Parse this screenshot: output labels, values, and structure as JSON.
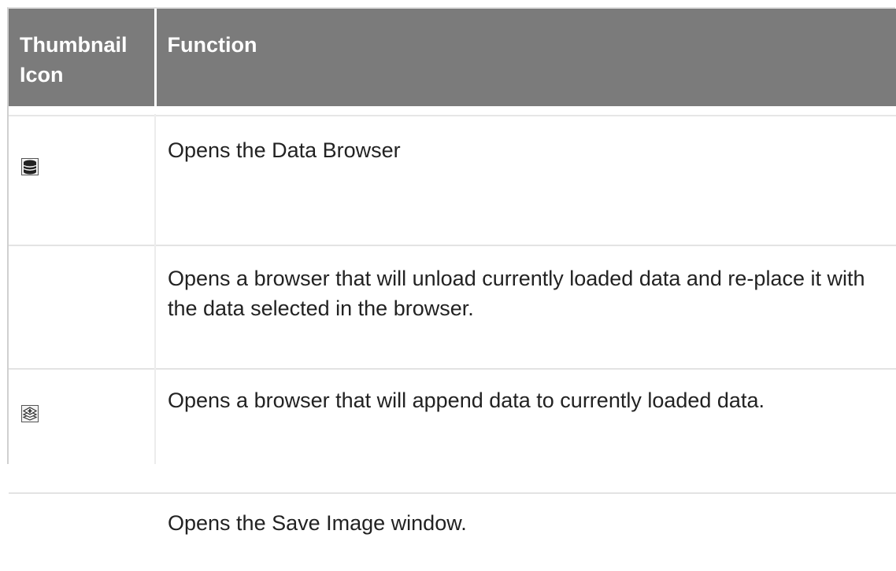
{
  "table": {
    "headers": {
      "icon_col": "Thumbnail Icon",
      "function_col": "Function"
    },
    "rows": [
      {
        "icon": "database-icon",
        "function": "Opens the Data Browser"
      },
      {
        "icon": "",
        "function": "Opens a browser that will unload currently loaded data and re-place it with the data selected in the browser."
      },
      {
        "icon": "append-layers-icon",
        "function": "Opens a browser that will append data to currently loaded data."
      },
      {
        "icon": "",
        "function": "Opens the Save Image window."
      }
    ]
  }
}
